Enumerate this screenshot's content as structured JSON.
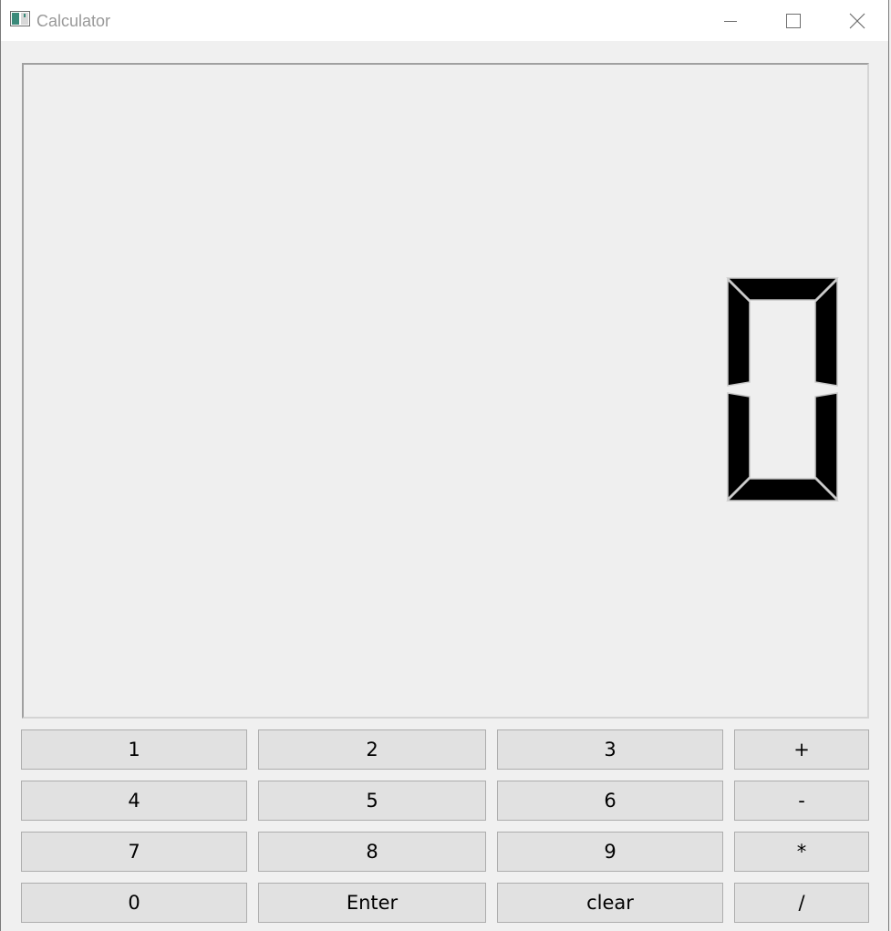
{
  "window": {
    "title": "Calculator",
    "controls": {
      "minimize_icon": "minimize-icon",
      "maximize_icon": "maximize-icon",
      "close_icon": "close-icon"
    }
  },
  "display": {
    "value": "0",
    "segment_color": "#000000"
  },
  "keypad": {
    "rows": [
      [
        "1",
        "2",
        "3",
        "+"
      ],
      [
        "4",
        "5",
        "6",
        "-"
      ],
      [
        "7",
        "8",
        "9",
        "*"
      ],
      [
        "0",
        "Enter",
        "clear",
        "/"
      ]
    ]
  },
  "colors": {
    "window_bg": "#f0f0f0",
    "button_bg": "#e1e1e1",
    "button_border": "#adadad",
    "title_text": "#999999"
  }
}
